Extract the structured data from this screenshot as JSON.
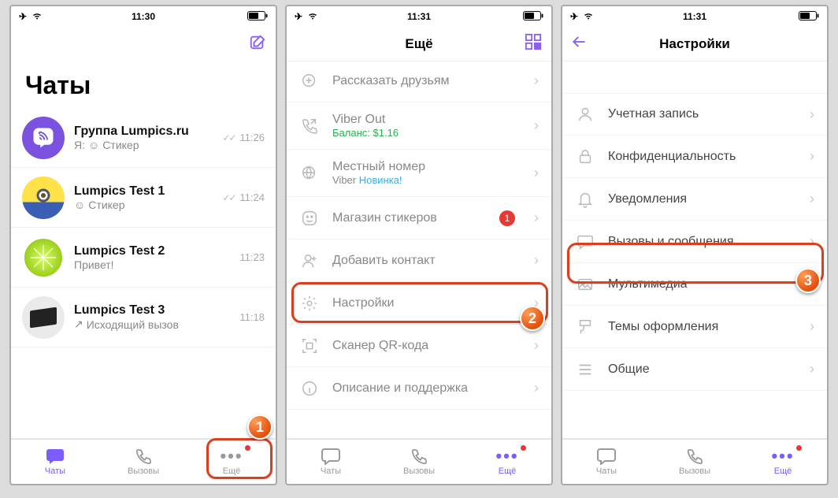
{
  "screen1": {
    "time": "11:30",
    "title": "Чаты",
    "chats": [
      {
        "name": "Группа Lumpics.ru",
        "sub_prefix": "Я:",
        "sub": "Стикер",
        "time": "11:26",
        "checks": true,
        "sticker_icon": true
      },
      {
        "name": "Lumpics Test 1",
        "sub_prefix": "",
        "sub": "Стикер",
        "time": "11:24",
        "checks": true,
        "sticker_icon": true
      },
      {
        "name": "Lumpics Test 2",
        "sub_prefix": "",
        "sub": "Привет!",
        "time": "11:23",
        "checks": false,
        "sticker_icon": false
      },
      {
        "name": "Lumpics Test 3",
        "sub_prefix": "",
        "sub": "Исходящий вызов",
        "time": "11:18",
        "checks": false,
        "sticker_icon": false,
        "outgoing": true
      }
    ],
    "tabs": {
      "chats": "Чаты",
      "calls": "Вызовы",
      "more": "Ещё"
    }
  },
  "screen2": {
    "time": "11:31",
    "title": "Ещё",
    "items": {
      "share": "Рассказать друзьям",
      "viber_out": "Viber Out",
      "balance_label": "Баланс:",
      "balance_value": "$1.16",
      "local_number_l1": "Местный номер",
      "local_number_l2_a": "Viber",
      "local_number_l2_b": "Новинка!",
      "stickers": "Магазин стикеров",
      "stickers_badge": "1",
      "add_contact": "Добавить контакт",
      "settings": "Настройки",
      "qr_scanner": "Сканер QR-кода",
      "support": "Описание и поддержка"
    },
    "tabs": {
      "chats": "Чаты",
      "calls": "Вызовы",
      "more": "Ещё"
    }
  },
  "screen3": {
    "time": "11:31",
    "title": "Настройки",
    "items": {
      "account": "Учетная запись",
      "privacy": "Конфиденциальность",
      "notifications": "Уведомления",
      "calls_msgs": "Вызовы и сообщения",
      "media": "Мультимедиа",
      "themes": "Темы оформления",
      "general": "Общие"
    },
    "tabs": {
      "chats": "Чаты",
      "calls": "Вызовы",
      "more": "Ещё"
    }
  },
  "badges": {
    "b1": "1",
    "b2": "2",
    "b3": "3"
  }
}
